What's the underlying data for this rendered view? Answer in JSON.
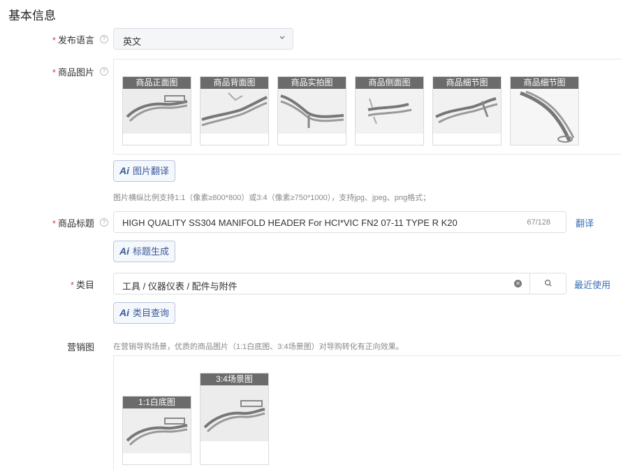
{
  "section": {
    "title": "基本信息"
  },
  "language": {
    "required": "*",
    "label": "发布语言",
    "value": "英文"
  },
  "images": {
    "required": "*",
    "label": "商品图片",
    "thumbs": [
      {
        "caption": "商品正面图"
      },
      {
        "caption": "商品背面图"
      },
      {
        "caption": "商品实拍图"
      },
      {
        "caption": "商品侧面图"
      },
      {
        "caption": "商品细节图"
      },
      {
        "caption": "商品细节图"
      }
    ],
    "translate_button": "图片翻译",
    "ai_mark": "Ai",
    "hint": "图片横纵比例支持1:1（像素≥800*800）或3:4（像素≥750*1000），支持jpg、jpeg、png格式；"
  },
  "title_field": {
    "required": "*",
    "label": "商品标题",
    "value": "HIGH QUALITY SS304 MANIFOLD HEADER For HCI*VIC FN2 07-11 TYPE R K20",
    "counter": "67/128",
    "translate_link": "翻译",
    "generate_button": "标题生成"
  },
  "category": {
    "required": "*",
    "label": "类目",
    "value": "工具 / 仪器仪表 / 配件与附件",
    "recent_link": "最近使用",
    "query_button": "类目查询"
  },
  "marketing": {
    "label": "营销图",
    "hint": "在营销导购场景，优质的商品图片（1:1白底图、3:4场景图）对导购转化有正向效果。",
    "thumbs": [
      {
        "caption": "1:1白底图"
      },
      {
        "caption": "3:4场景图"
      }
    ]
  },
  "icons": {
    "help": "question-circle-icon",
    "chevron": "chevron-down-icon",
    "clear": "clear-circle-icon",
    "search": "search-icon"
  }
}
